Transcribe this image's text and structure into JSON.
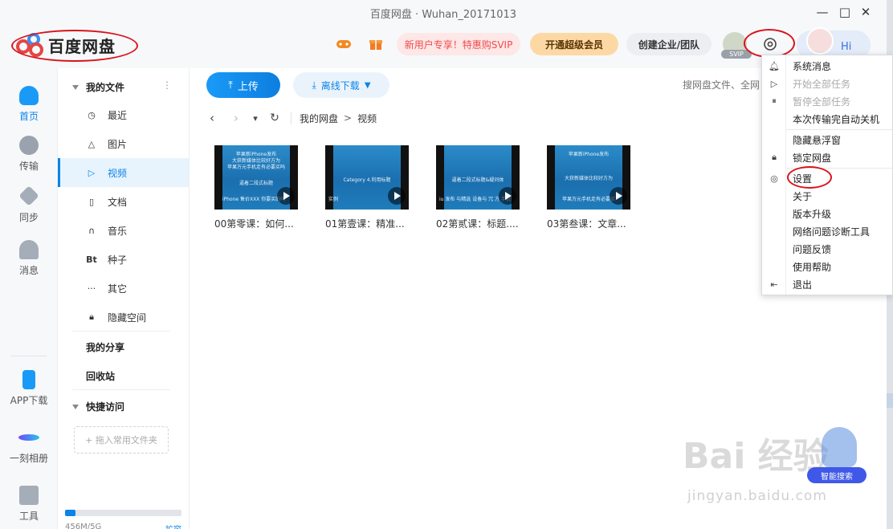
{
  "window": {
    "title": "百度网盘 · Wuhan_20171013",
    "minimize_glyph": "—",
    "maximize_glyph": "□",
    "close_glyph": "✕"
  },
  "header": {
    "logo_text": "百度网盘",
    "svip_promo": "新用户专享！特惠购SVIP",
    "svip_open": "开通超级会员",
    "enterprise": "创建企业/团队",
    "svip_badge": "SVIP",
    "greeting": "Hi",
    "colors": {
      "brand_red": "#e54545",
      "accent_blue": "#0a84e8"
    }
  },
  "rail": {
    "items": [
      {
        "label": "首页",
        "icon": "cloud-icon"
      },
      {
        "label": "传输",
        "icon": "transfer-icon"
      },
      {
        "label": "同步",
        "icon": "sync-icon"
      },
      {
        "label": "消息",
        "icon": "message-icon"
      },
      {
        "label": "APP下载",
        "icon": "phone-icon"
      },
      {
        "label": "一刻相册",
        "icon": "album-icon"
      },
      {
        "label": "工具",
        "icon": "tools-icon"
      }
    ]
  },
  "nav": {
    "my_files": "我的文件",
    "more_glyph": "⋮",
    "items": [
      {
        "label": "最近",
        "icon": "clock-icon",
        "glyph": "◷"
      },
      {
        "label": "图片",
        "icon": "image-icon",
        "glyph": "△"
      },
      {
        "label": "视频",
        "icon": "video-icon",
        "glyph": "▷"
      },
      {
        "label": "文档",
        "icon": "document-icon",
        "glyph": "▯"
      },
      {
        "label": "音乐",
        "icon": "headphones-icon",
        "glyph": "∩"
      },
      {
        "label": "种子",
        "icon": "bt-icon",
        "glyph": "Bt"
      },
      {
        "label": "其它",
        "icon": "more-icon",
        "glyph": "···"
      },
      {
        "label": "隐藏空间",
        "icon": "lock-icon",
        "glyph": "🔒︎"
      }
    ],
    "my_share": "我的分享",
    "recycle": "回收站",
    "quick_access": "快捷访问",
    "drop_folder": "+ 拖入常用文件夹",
    "storage_text": "456M/5G",
    "expand": "扩容",
    "storage_used_fraction": 0.09
  },
  "toolbar": {
    "upload": "上传",
    "offline": "离线下载",
    "search_placeholder": "搜网盘文件、全网"
  },
  "breadcrumb": {
    "back_glyph": "‹",
    "forward_glyph": "›",
    "dropdown_glyph": "▾",
    "refresh_glyph": "↻",
    "root": "我的网盘",
    "separator": ">",
    "current": "视频"
  },
  "files": [
    {
      "name": "00第零课：如何...",
      "thumb_lines": [
        "苹果新iPhone发布",
        "大获新媒体比较好方为",
        "苹果万元手机走有必要买吗",
        "",
        "逼着二段式标题",
        "",
        "iPhone 售价XXX 你要买的吗"
      ]
    },
    {
      "name": "01第壹课：精准...",
      "thumb_lines": [
        "",
        "",
        "",
        "Category 4.利用标题",
        "",
        "",
        "实例"
      ]
    },
    {
      "name": "02第贰课：标题....",
      "thumb_lines": [
        "",
        "",
        "",
        "逼着二段式标题&疑问体",
        "",
        "",
        "iu 发布 与精选 设备与 冗 方 手机值得 了么?"
      ]
    },
    {
      "name": "03第叁课：文章...",
      "thumb_lines": [
        "苹果新iPhone发布",
        "",
        "",
        "大获新媒体比较好方为",
        "",
        "",
        "苹果万元手机走有必要买"
      ]
    }
  ],
  "menu": {
    "items": [
      {
        "label": "系统消息",
        "icon": "bell-icon",
        "glyph": "🔔︎",
        "disabled": false
      },
      {
        "label": "开始全部任务",
        "icon": "play-icon",
        "glyph": "▷",
        "disabled": true
      },
      {
        "label": "暂停全部任务",
        "icon": "pause-icon",
        "glyph": "⏸︎",
        "disabled": true
      },
      {
        "label": "本次传输完自动关机",
        "icon": "",
        "glyph": "",
        "disabled": false
      },
      {
        "label": "隐藏悬浮窗",
        "icon": "",
        "glyph": "",
        "disabled": false
      },
      {
        "label": "锁定网盘",
        "icon": "lock-icon",
        "glyph": "🔒︎",
        "disabled": false
      },
      {
        "label": "设置",
        "icon": "gear-icon",
        "glyph": "◎",
        "disabled": false
      },
      {
        "label": "关于",
        "icon": "",
        "glyph": "",
        "disabled": false
      },
      {
        "label": "版本升级",
        "icon": "",
        "glyph": "",
        "disabled": false
      },
      {
        "label": "网络问题诊断工具",
        "icon": "",
        "glyph": "",
        "disabled": false
      },
      {
        "label": "问题反馈",
        "icon": "",
        "glyph": "",
        "disabled": false
      },
      {
        "label": "使用帮助",
        "icon": "",
        "glyph": "",
        "disabled": false
      },
      {
        "label": "退出",
        "icon": "exit-icon",
        "glyph": "⇤",
        "disabled": false
      }
    ]
  },
  "watermark": {
    "brand": "Bai 经验",
    "url": "jingyan.baidu.com",
    "robot_tag": "智能搜索"
  }
}
